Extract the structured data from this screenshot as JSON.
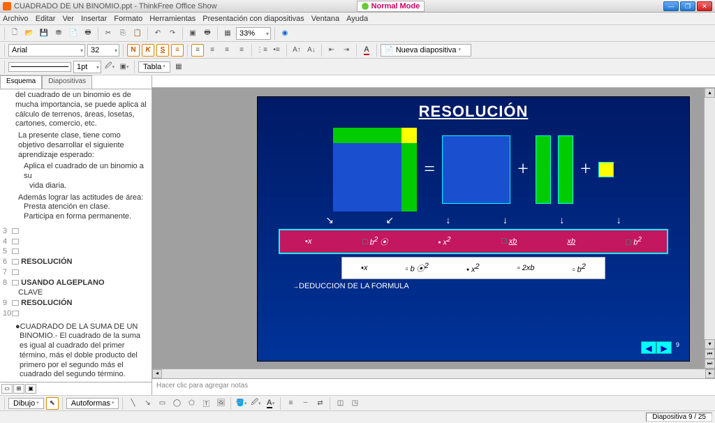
{
  "title": "CUADRADO DE UN BINOMIO.ppt - ThinkFree Office Show",
  "mode": "Normal Mode",
  "menu": [
    "Archivo",
    "Editar",
    "Ver",
    "Insertar",
    "Formato",
    "Herramientas",
    "Presentación con diapositivas",
    "Ventana",
    "Ayuda"
  ],
  "zoom": "33%",
  "font": {
    "name": "Arial",
    "size": "32"
  },
  "linept": "1pt",
  "table_label": "Tabla",
  "newslide_label": "Nueva diapositiva",
  "tabs": {
    "outline": "Esquema",
    "slides": "Diapositivas"
  },
  "outline_text": {
    "para1": "del cuadrado de un binomio es de mucha importancia, se puede aplica al cálculo de terrenos, áreas, losetas, cartones, comercio, etc.",
    "para2": "La presente clase, tiene como objetivo desarrollar el siguiente aprendizaje esperado:",
    "para3": "Aplica el cuadrado de un binomio a su",
    "para4": "vida diaria.",
    "para5": "Además lograr las actitudes de área:",
    "para6": "Presta atención en clase.",
    "para7": "Participa en forma permanente.",
    "items": [
      {
        "n": "3"
      },
      {
        "n": "4"
      },
      {
        "n": "5"
      },
      {
        "n": "6",
        "title": "RESOLUCIÓN"
      },
      {
        "n": "7"
      },
      {
        "n": "8",
        "title": "USANDO ALGEPLANO",
        "sub": "CLAVE"
      },
      {
        "n": "9",
        "title": "RESOLUCIÓN"
      },
      {
        "n": "10"
      }
    ],
    "bullet_title": "CUADRADO DE LA SUMA DE UN",
    "bullet_body": "BINOMIO.- El cuadrado de la suma es igual al cuadrado del primer término, más el doble producto del primero por el segundo más el cuadrado del segundo término."
  },
  "slide": {
    "title": "RESOLUCIÓN",
    "eq": "=",
    "plus": "+",
    "pink": [
      "x",
      "b",
      "x",
      "xb",
      "xb",
      "b"
    ],
    "white_terms": [
      "x",
      "b",
      "x",
      "2xb",
      "b"
    ],
    "deduccion": "DEDUCCION DE LA FORMULA",
    "pagenum": "9"
  },
  "notes_placeholder": "Hacer clic para agregar notas",
  "draw": {
    "dibujo": "Dibujo",
    "autoformas": "Autoformas"
  },
  "status": "Diapositiva 9 / 25"
}
